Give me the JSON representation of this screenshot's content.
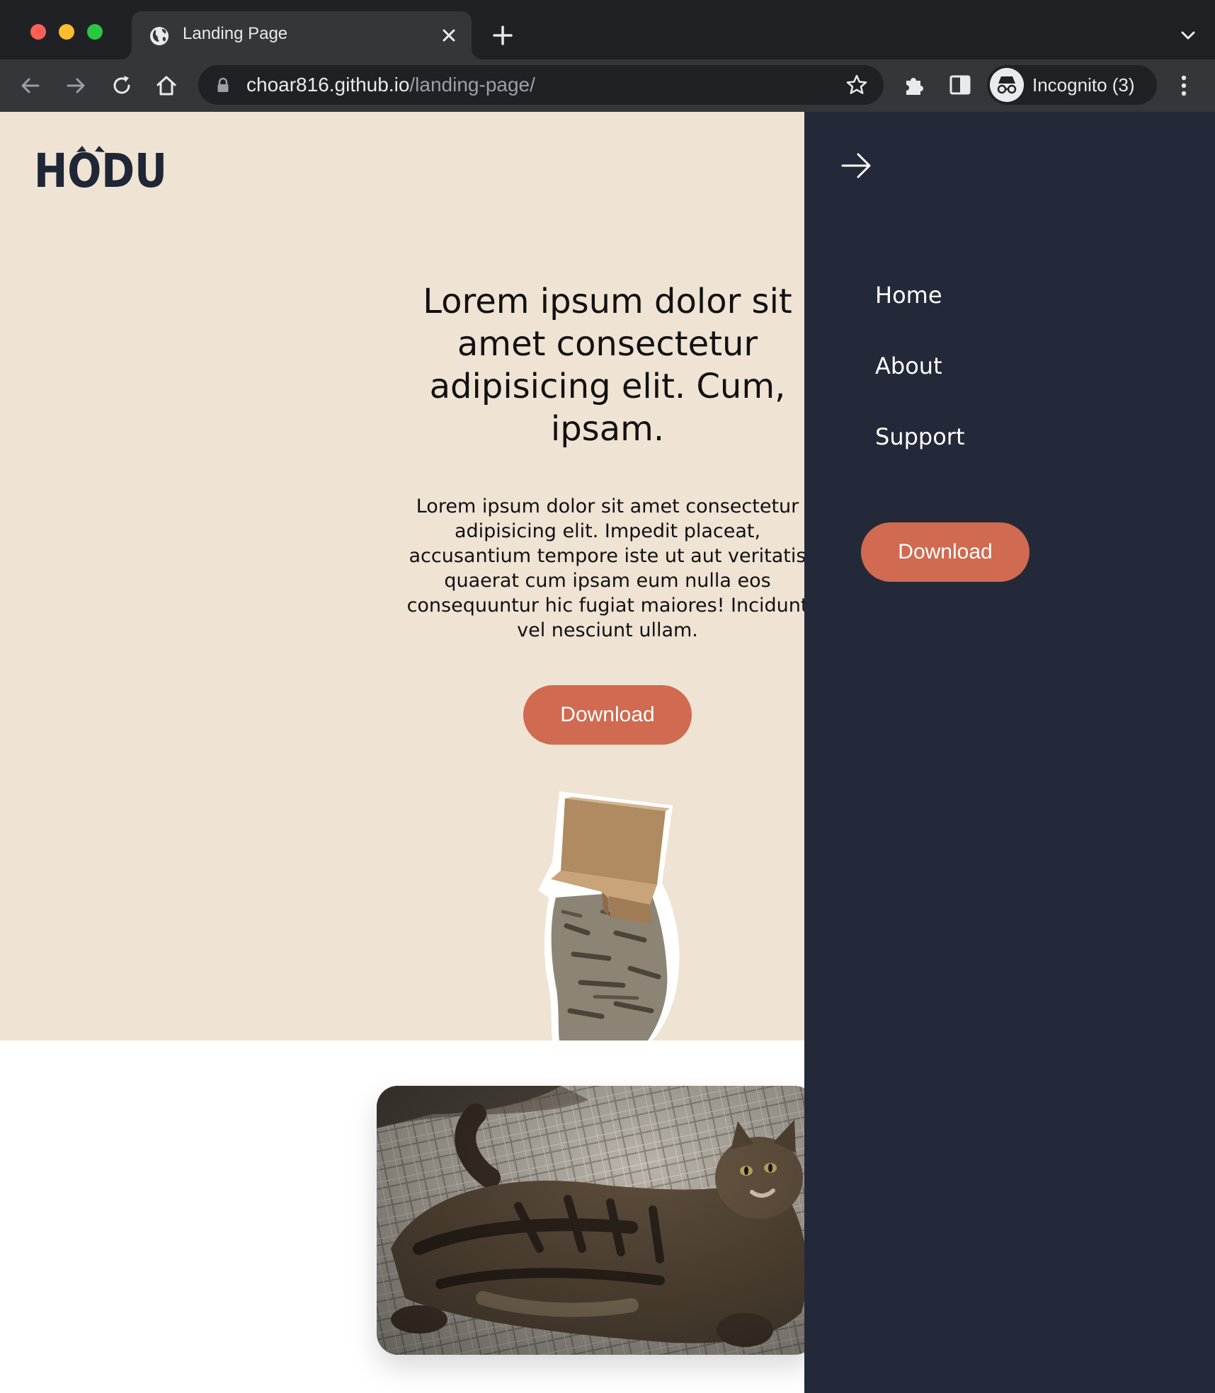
{
  "browser": {
    "tab_title": "Landing Page",
    "url_host": "choar816.github.io",
    "url_path": "/landing-page/",
    "profile_label": "Incognito (3)"
  },
  "page": {
    "logo_text": "HODU",
    "hero": {
      "title": "Lorem ipsum dolor sit amet consectetur adipisicing elit. Cum, ipsam.",
      "text": "Lorem ipsum dolor sit amet consectetur adipisicing elit. Impedit placeat, accusantium tempore iste ut aut veritatis quaerat cum ipsam eum nulla eos consequuntur hic fugiat maiores! Incidunt vel nesciunt ullam.",
      "download_label": "Download"
    }
  },
  "sidemenu": {
    "items": [
      {
        "label": "Home"
      },
      {
        "label": "About"
      },
      {
        "label": "Support"
      }
    ],
    "download_label": "Download"
  },
  "colors": {
    "hero_bg": "#efe3d4",
    "menu_bg": "#232938",
    "accent": "#d06a50",
    "logo": "#1f2636"
  }
}
